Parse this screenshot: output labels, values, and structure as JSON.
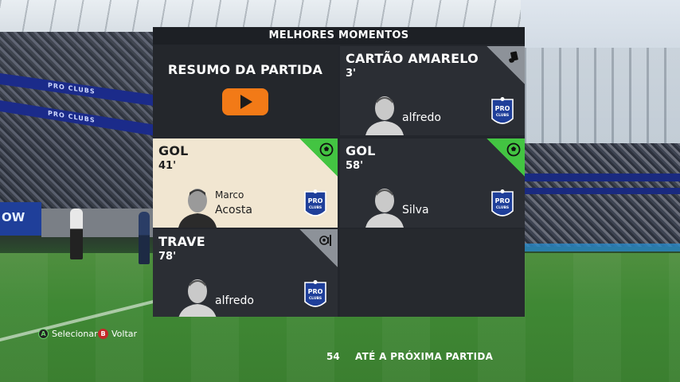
{
  "panel": {
    "title": "MELHORES MOMENTOS"
  },
  "summary": {
    "label": "RESUMO DA PARTIDA"
  },
  "events": {
    "card": {
      "title": "CARTÃO AMARELO",
      "minute": "3'",
      "player": "alfredo",
      "icon": "yellow-card-icon"
    },
    "goal1": {
      "title": "GOL",
      "minute": "41'",
      "player_first": "Marco",
      "player": "Acosta",
      "icon": "soccer-ball-icon"
    },
    "goal2": {
      "title": "GOL",
      "minute": "58'",
      "player": "Silva",
      "icon": "soccer-ball-icon"
    },
    "bar": {
      "title": "TRAVE",
      "minute": "78'",
      "player": "alfredo",
      "icon": "goalpost-icon"
    }
  },
  "badge": {
    "line1": "PRO",
    "line2": "CLUBS"
  },
  "stadium": {
    "board_text": "PRO CLUBS",
    "ad_text": "OW"
  },
  "footer": {
    "select": {
      "key": "A",
      "label": "Selecionar"
    },
    "back": {
      "key": "B",
      "label": "Voltar"
    },
    "countdown": "54",
    "countdown_label": "ATÉ A PRÓXIMA PARTIDA"
  },
  "colors": {
    "goal_accent": "#43c442",
    "play_button": "#f27a17",
    "highlight_card": "#f1e6d1",
    "panel_bg": "#23262c"
  }
}
